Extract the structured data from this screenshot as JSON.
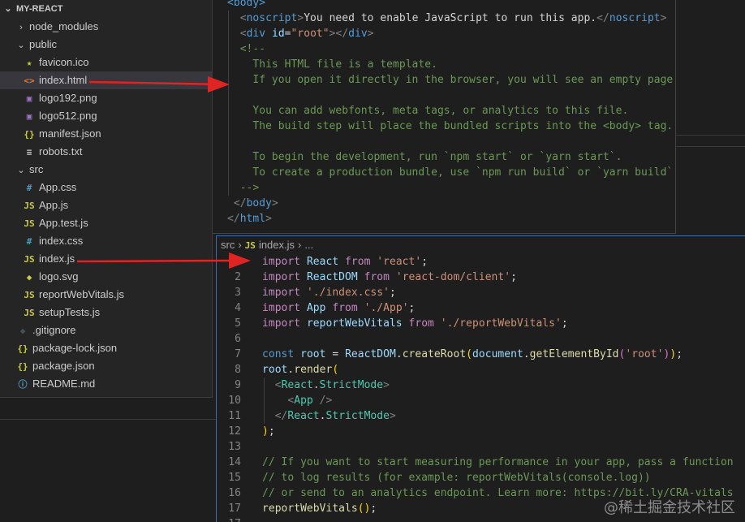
{
  "explorer": {
    "root_label": "MY-REACT",
    "items": [
      {
        "label": "node_modules",
        "kind": "folder-closed",
        "depth": 1,
        "icon": "chevron-right-icon"
      },
      {
        "label": "public",
        "kind": "folder-open",
        "depth": 1,
        "icon": "chevron-down-icon"
      },
      {
        "label": "favicon.ico",
        "kind": "file",
        "depth": 2,
        "glyph": "★",
        "icon": "star-icon",
        "color": "#cbcb41"
      },
      {
        "label": "index.html",
        "kind": "file",
        "depth": 2,
        "glyph": "<>",
        "icon": "html-icon",
        "color": "#e37933",
        "selected": true
      },
      {
        "label": "logo192.png",
        "kind": "file",
        "depth": 2,
        "glyph": "▣",
        "icon": "image-icon",
        "color": "#a074c4"
      },
      {
        "label": "logo512.png",
        "kind": "file",
        "depth": 2,
        "glyph": "▣",
        "icon": "image-icon",
        "color": "#a074c4"
      },
      {
        "label": "manifest.json",
        "kind": "file",
        "depth": 2,
        "glyph": "{}",
        "icon": "json-icon",
        "color": "#cbcb41"
      },
      {
        "label": "robots.txt",
        "kind": "file",
        "depth": 2,
        "glyph": "≡",
        "icon": "text-file-icon",
        "color": "#cccccc"
      },
      {
        "label": "src",
        "kind": "folder-open",
        "depth": 1,
        "icon": "chevron-down-icon"
      },
      {
        "label": "App.css",
        "kind": "file",
        "depth": 2,
        "glyph": "#",
        "icon": "css-icon",
        "color": "#519aba"
      },
      {
        "label": "App.js",
        "kind": "file",
        "depth": 2,
        "glyph": "JS",
        "icon": "js-icon",
        "color": "#cbcb41"
      },
      {
        "label": "App.test.js",
        "kind": "file",
        "depth": 2,
        "glyph": "JS",
        "icon": "js-icon",
        "color": "#cbcb41"
      },
      {
        "label": "index.css",
        "kind": "file",
        "depth": 2,
        "glyph": "#",
        "icon": "css-icon",
        "color": "#519aba"
      },
      {
        "label": "index.js",
        "kind": "file",
        "depth": 2,
        "glyph": "JS",
        "icon": "js-icon",
        "color": "#cbcb41"
      },
      {
        "label": "logo.svg",
        "kind": "file",
        "depth": 2,
        "glyph": "◆",
        "icon": "svg-icon",
        "color": "#cbcb41"
      },
      {
        "label": "reportWebVitals.js",
        "kind": "file",
        "depth": 2,
        "glyph": "JS",
        "icon": "js-icon",
        "color": "#cbcb41"
      },
      {
        "label": "setupTests.js",
        "kind": "file",
        "depth": 2,
        "glyph": "JS",
        "icon": "js-icon",
        "color": "#cbcb41"
      },
      {
        "label": ".gitignore",
        "kind": "file",
        "depth": 1,
        "glyph": "◆",
        "icon": "git-icon",
        "color": "#41535b"
      },
      {
        "label": "package-lock.json",
        "kind": "file",
        "depth": 1,
        "glyph": "{}",
        "icon": "json-icon",
        "color": "#cbcb41"
      },
      {
        "label": "package.json",
        "kind": "file",
        "depth": 1,
        "glyph": "{}",
        "icon": "json-icon",
        "color": "#cbcb41"
      },
      {
        "label": "README.md",
        "kind": "file",
        "depth": 1,
        "glyph": "ⓘ",
        "icon": "info-icon",
        "color": "#519aba"
      }
    ]
  },
  "html_editor": {
    "lines": [
      [
        [
          "tag",
          "<"
        ],
        [
          "tagname",
          "body"
        ],
        [
          "tag",
          ">"
        ]
      ],
      [
        [
          "txt",
          "  "
        ],
        [
          "gray-tag",
          "<"
        ],
        [
          "tagname",
          "noscript"
        ],
        [
          "gray-tag",
          ">"
        ],
        [
          "txt",
          "You need to enable JavaScript to run this app."
        ],
        [
          "gray-tag",
          "</"
        ],
        [
          "tagname",
          "noscript"
        ],
        [
          "gray-tag",
          ">"
        ]
      ],
      [
        [
          "txt",
          "  "
        ],
        [
          "gray-tag",
          "<"
        ],
        [
          "tagname",
          "div"
        ],
        [
          "txt",
          " "
        ],
        [
          "attr",
          "id"
        ],
        [
          "txt",
          "="
        ],
        [
          "str",
          "\"root\""
        ],
        [
          "gray-tag",
          "></"
        ],
        [
          "tagname",
          "div"
        ],
        [
          "gray-tag",
          ">"
        ]
      ],
      [
        [
          "txt",
          "  "
        ],
        [
          "cmt",
          "<!--"
        ]
      ],
      [
        [
          "cmt",
          "    This HTML file is a template."
        ]
      ],
      [
        [
          "cmt",
          "    If you open it directly in the browser, you will see an empty page."
        ]
      ],
      [
        [
          "cmt",
          ""
        ]
      ],
      [
        [
          "cmt",
          "    You can add webfonts, meta tags, or analytics to this file."
        ]
      ],
      [
        [
          "cmt",
          "    The build step will place the bundled scripts into the <body> tag."
        ]
      ],
      [
        [
          "cmt",
          ""
        ]
      ],
      [
        [
          "cmt",
          "    To begin the development, run `npm start` or `yarn start`."
        ]
      ],
      [
        [
          "cmt",
          "    To create a production bundle, use `npm run build` or `yarn build`."
        ]
      ],
      [
        [
          "txt",
          "  "
        ],
        [
          "cmt",
          "-->"
        ]
      ],
      [
        [
          "txt",
          " "
        ],
        [
          "gray-tag",
          "</"
        ],
        [
          "tagname",
          "body"
        ],
        [
          "gray-tag",
          ">"
        ]
      ],
      [
        [
          "gray-tag",
          "</"
        ],
        [
          "tagname",
          "html"
        ],
        [
          "gray-tag",
          ">"
        ]
      ]
    ]
  },
  "js_editor": {
    "breadcrumb": {
      "folder": "src",
      "badge": "JS",
      "file": "index.js",
      "more": "..."
    },
    "lines": [
      {
        "no": "",
        "tokens": [
          [
            "kw",
            "import"
          ],
          [
            "txt",
            " "
          ],
          [
            "id",
            "React"
          ],
          [
            "txt",
            " "
          ],
          [
            "kw",
            "from"
          ],
          [
            "txt",
            " "
          ],
          [
            "str",
            "'react'"
          ],
          [
            "pun",
            ";"
          ]
        ]
      },
      {
        "no": "2",
        "tokens": [
          [
            "kw",
            "import"
          ],
          [
            "txt",
            " "
          ],
          [
            "id",
            "ReactDOM"
          ],
          [
            "txt",
            " "
          ],
          [
            "kw",
            "from"
          ],
          [
            "txt",
            " "
          ],
          [
            "str",
            "'react-dom/client'"
          ],
          [
            "pun",
            ";"
          ]
        ]
      },
      {
        "no": "3",
        "tokens": [
          [
            "kw",
            "import"
          ],
          [
            "txt",
            " "
          ],
          [
            "str",
            "'./index.css'"
          ],
          [
            "pun",
            ";"
          ]
        ]
      },
      {
        "no": "4",
        "tokens": [
          [
            "kw",
            "import"
          ],
          [
            "txt",
            " "
          ],
          [
            "id",
            "App"
          ],
          [
            "txt",
            " "
          ],
          [
            "kw",
            "from"
          ],
          [
            "txt",
            " "
          ],
          [
            "str",
            "'./App'"
          ],
          [
            "pun",
            ";"
          ]
        ]
      },
      {
        "no": "5",
        "tokens": [
          [
            "kw",
            "import"
          ],
          [
            "txt",
            " "
          ],
          [
            "id",
            "reportWebVitals"
          ],
          [
            "txt",
            " "
          ],
          [
            "kw",
            "from"
          ],
          [
            "txt",
            " "
          ],
          [
            "str",
            "'./reportWebVitals'"
          ],
          [
            "pun",
            ";"
          ]
        ]
      },
      {
        "no": "6",
        "tokens": []
      },
      {
        "no": "7",
        "tokens": [
          [
            "kw2",
            "const"
          ],
          [
            "txt",
            " "
          ],
          [
            "id",
            "root"
          ],
          [
            "txt",
            " "
          ],
          [
            "pun",
            "="
          ],
          [
            "txt",
            " "
          ],
          [
            "id",
            "ReactDOM"
          ],
          [
            "pun",
            "."
          ],
          [
            "fn",
            "createRoot"
          ],
          [
            "brk1",
            "("
          ],
          [
            "id",
            "document"
          ],
          [
            "pun",
            "."
          ],
          [
            "fn",
            "getElementById"
          ],
          [
            "brk2",
            "("
          ],
          [
            "str",
            "'root'"
          ],
          [
            "brk2",
            ")"
          ],
          [
            "brk1",
            ")"
          ],
          [
            "pun",
            ";"
          ]
        ]
      },
      {
        "no": "8",
        "tokens": [
          [
            "id",
            "root"
          ],
          [
            "pun",
            "."
          ],
          [
            "fn",
            "render"
          ],
          [
            "brk1",
            "("
          ]
        ]
      },
      {
        "no": "9",
        "tokens": [
          [
            "txt",
            "  "
          ],
          [
            "gray-tag",
            "<"
          ],
          [
            "cls",
            "React"
          ],
          [
            "pun",
            "."
          ],
          [
            "cls",
            "StrictMode"
          ],
          [
            "gray-tag",
            ">"
          ]
        ]
      },
      {
        "no": "10",
        "tokens": [
          [
            "txt",
            "    "
          ],
          [
            "gray-tag",
            "<"
          ],
          [
            "cls",
            "App"
          ],
          [
            "txt",
            " "
          ],
          [
            "gray-tag",
            "/>"
          ]
        ]
      },
      {
        "no": "11",
        "tokens": [
          [
            "txt",
            "  "
          ],
          [
            "gray-tag",
            "</"
          ],
          [
            "cls",
            "React"
          ],
          [
            "pun",
            "."
          ],
          [
            "cls",
            "StrictMode"
          ],
          [
            "gray-tag",
            ">"
          ]
        ]
      },
      {
        "no": "12",
        "tokens": [
          [
            "brk1",
            ")"
          ],
          [
            "pun",
            ";"
          ]
        ]
      },
      {
        "no": "13",
        "tokens": []
      },
      {
        "no": "14",
        "tokens": [
          [
            "cmt",
            "// If you want to start measuring performance in your app, pass a function"
          ]
        ]
      },
      {
        "no": "15",
        "tokens": [
          [
            "cmt",
            "// to log results (for example: reportWebVitals(console.log))"
          ]
        ]
      },
      {
        "no": "16",
        "tokens": [
          [
            "cmt",
            "// or send to an analytics endpoint. Learn more: https://bit.ly/CRA-vitals"
          ]
        ]
      },
      {
        "no": "17",
        "tokens": [
          [
            "fn",
            "reportWebVitals"
          ],
          [
            "brk1",
            "("
          ],
          [
            "brk1",
            ")"
          ],
          [
            "pun",
            ";"
          ]
        ]
      },
      {
        "no": "17",
        "tokens": []
      }
    ]
  },
  "watermark": "@稀土掘金技术社区",
  "colors": {
    "arrow": "#e02424",
    "accent_border": "#3d6ea3"
  }
}
